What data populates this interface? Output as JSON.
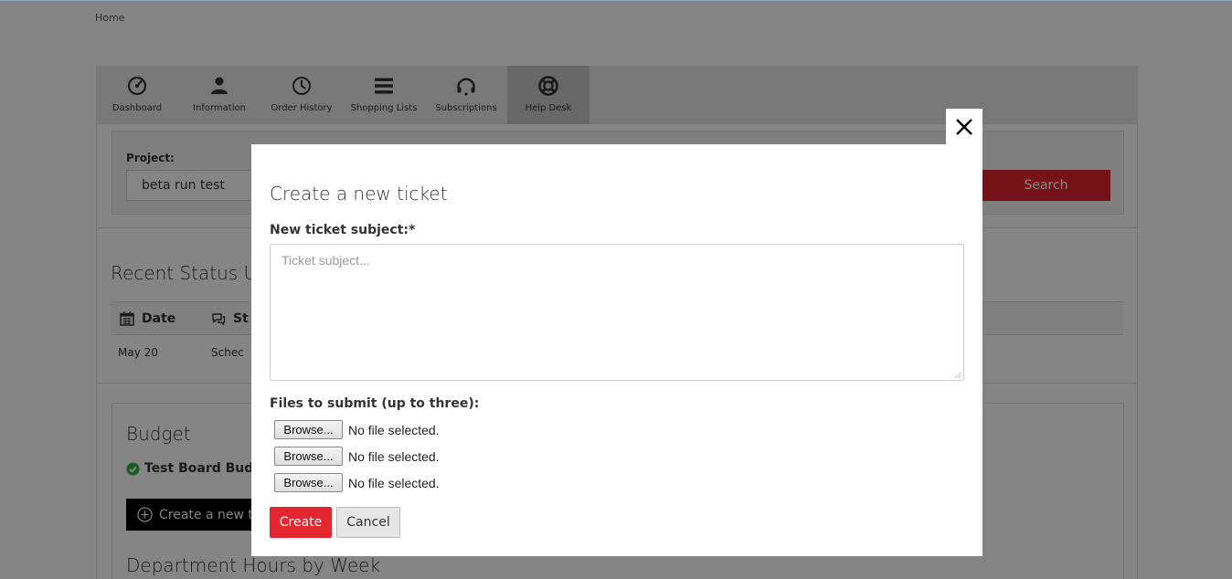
{
  "breadcrumb": {
    "home": "Home"
  },
  "nav": {
    "items": [
      {
        "label": "Dashboard",
        "icon": "dashboard-gauge-icon",
        "active": false
      },
      {
        "label": "Information",
        "icon": "user-icon",
        "active": false
      },
      {
        "label": "Order History",
        "icon": "clock-icon",
        "active": false
      },
      {
        "label": "Shopping Lists",
        "icon": "list-icon",
        "active": false
      },
      {
        "label": "Subscriptions",
        "icon": "headset-icon",
        "active": false
      },
      {
        "label": "Help Desk",
        "icon": "lifebuoy-icon",
        "active": true
      }
    ]
  },
  "filter": {
    "project_label": "Project:",
    "project_value": "beta run test",
    "search_label": "Search"
  },
  "status": {
    "title": "Recent Status Up",
    "col_date": "Date",
    "col_status": "St",
    "rows": [
      {
        "date": "May 20",
        "status": "Schec"
      }
    ]
  },
  "budget": {
    "title": "Budget",
    "item": "Test Board Budge",
    "create_ticket_label": "Create a new tic",
    "dept_title": "Department Hours by Week"
  },
  "modal": {
    "title": "Create a new ticket",
    "subject_label": "New ticket subject:*",
    "subject_placeholder": "Ticket subject...",
    "subject_value": "",
    "files_label": "Files to submit (up to three):",
    "files": [
      {
        "button": "Browse...",
        "status": "No file selected."
      },
      {
        "button": "Browse...",
        "status": "No file selected."
      },
      {
        "button": "Browse...",
        "status": "No file selected."
      }
    ],
    "create_label": "Create",
    "cancel_label": "Cancel"
  },
  "colors": {
    "accent": "#e2252e",
    "overlay": "rgba(0,0,0,0.48)",
    "nav_bg": "#e9e9e9",
    "nav_active": "#c8c8c8"
  }
}
